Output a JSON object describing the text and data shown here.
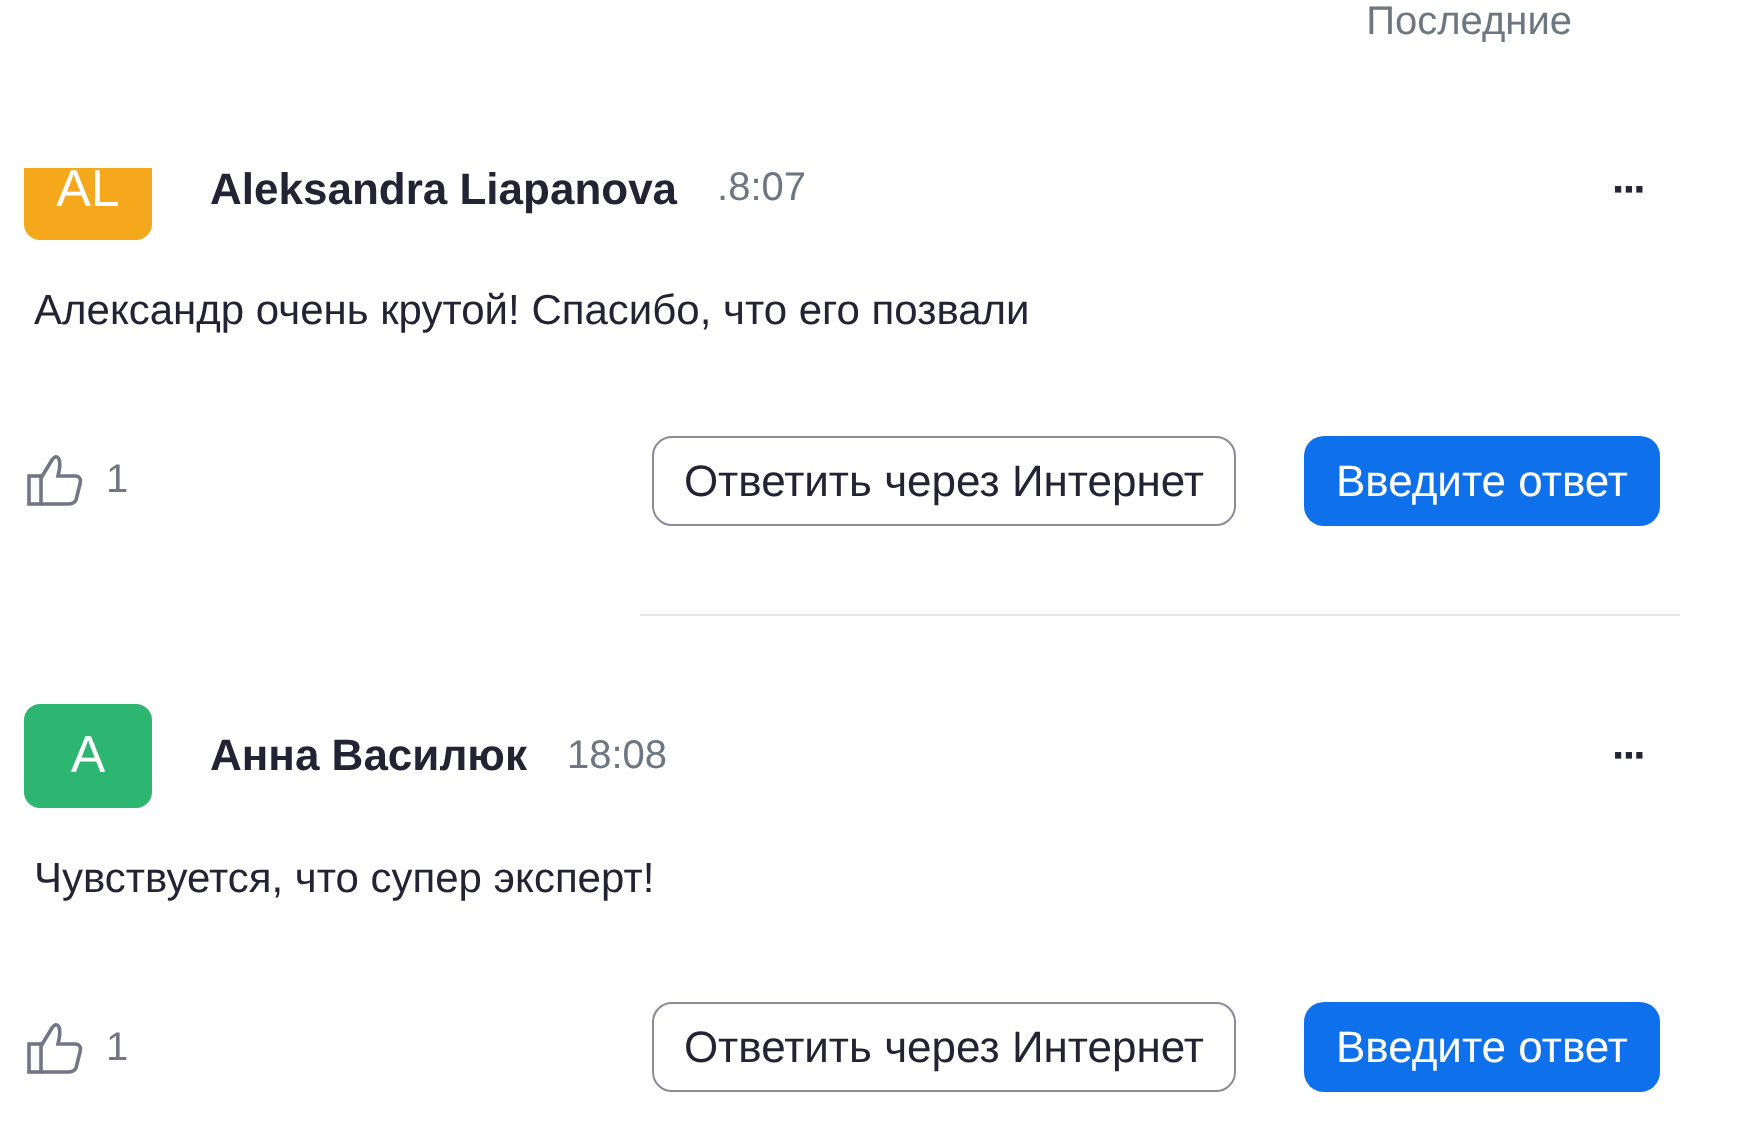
{
  "header": {
    "sort_label": "Последние"
  },
  "questions": [
    {
      "kind": "cut_off",
      "avatar_initials": "AL",
      "color": "#f6a81c",
      "author": "Aleksandra Liapanova",
      "time": ".8:07",
      "more": "···",
      "text": "Александр очень крутой! Спасибо, что его позвали",
      "likes": "1",
      "reply_online": "Ответить через Интернет",
      "type_answer": "Введите ответ"
    },
    {
      "kind": "full",
      "avatar_initials": "А",
      "color": "#2db572",
      "author": "Анна Василюк",
      "time": "18:08",
      "more": "···",
      "text": "Чувствуется, что супер эксперт!",
      "likes": "1",
      "reply_online": "Ответить через Интернет",
      "type_answer": "Введите ответ"
    }
  ]
}
